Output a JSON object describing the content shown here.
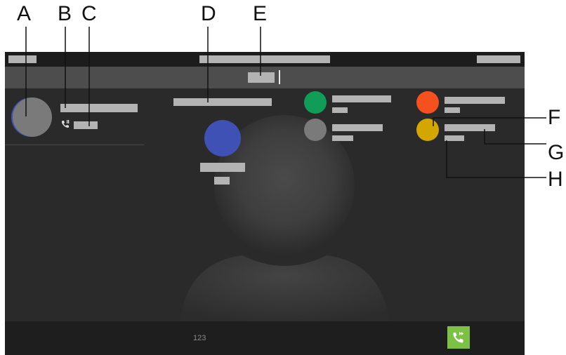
{
  "callouts": {
    "a": "A",
    "b": "B",
    "c": "C",
    "d": "D",
    "e": "E",
    "f": "F",
    "g": "G",
    "h": "H"
  },
  "bottom_bar": {
    "keypad_label": "123"
  },
  "icons": {
    "call_type": "phone-incoming-icon",
    "transfer": "call-transfer-icon"
  },
  "colors": {
    "contact_green": "#0f9d58",
    "contact_gray": "#7a7a7a",
    "contact_orange": "#f4511e",
    "contact_yellow": "#d4a600",
    "caller_blue": "#3f51b5",
    "transfer_button": "#7cc044"
  }
}
